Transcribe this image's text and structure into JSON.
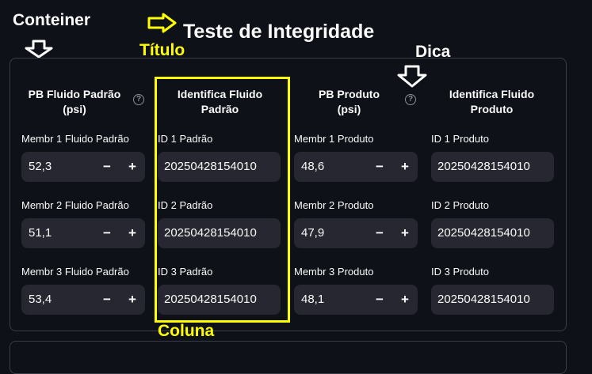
{
  "annotations": {
    "conteiner": "Conteiner",
    "titulo": "Título",
    "dica": "Dica",
    "coluna": "Coluna"
  },
  "page_title": "Teste de Integridade",
  "columns": [
    {
      "header": "PB Fluido Padrão (psi)",
      "help": "?"
    },
    {
      "header": "Identifica Fluido Padrão"
    },
    {
      "header": "PB Produto (psi)",
      "help": "?"
    },
    {
      "header": "Identifica Fluido Produto"
    }
  ],
  "rows": [
    {
      "pb_padrao_label": "Membr 1 Fluido Padrão",
      "pb_padrao_value": "52,3",
      "id_padrao_label": "ID 1 Padrão",
      "id_padrao_value": "20250428154010",
      "pb_produto_label": "Membr 1 Produto",
      "pb_produto_value": "48,6",
      "id_produto_label": "ID 1 Produto",
      "id_produto_value": "20250428154010"
    },
    {
      "pb_padrao_label": "Membr 2 Fluido Padrão",
      "pb_padrao_value": "51,1",
      "id_padrao_label": "ID 2 Padrão",
      "id_padrao_value": "20250428154010",
      "pb_produto_label": "Membr 2 Produto",
      "pb_produto_value": "47,9",
      "id_produto_label": "ID 2 Produto",
      "id_produto_value": "20250428154010"
    },
    {
      "pb_padrao_label": "Membr 3 Fluido Padrão",
      "pb_padrao_value": "53,4",
      "id_padrao_label": "ID 3 Padrão",
      "id_padrao_value": "20250428154010",
      "pb_produto_label": "Membr 3 Produto",
      "pb_produto_value": "48,1",
      "id_produto_label": "ID 3 Produto",
      "id_produto_value": "20250428154010"
    }
  ],
  "stepper": {
    "minus": "−",
    "plus": "+"
  },
  "colors": {
    "background": "#0e1117",
    "input": "#262730",
    "annotation": "#ffff00"
  }
}
